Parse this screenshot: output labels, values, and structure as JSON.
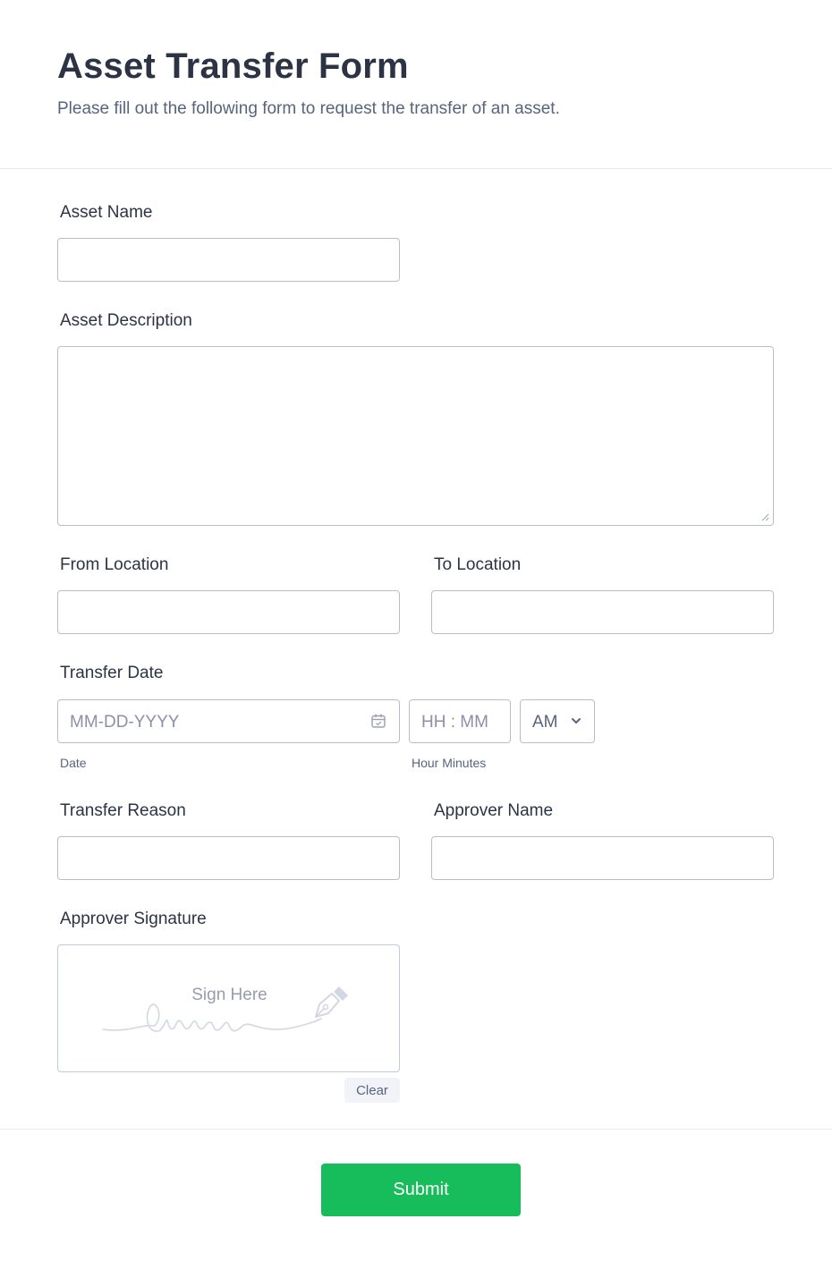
{
  "header": {
    "title": "Asset Transfer Form",
    "subtitle": "Please fill out the following form to request the transfer of an asset."
  },
  "fields": {
    "asset_name": {
      "label": "Asset Name",
      "value": ""
    },
    "asset_description": {
      "label": "Asset Description",
      "value": ""
    },
    "from_location": {
      "label": "From Location",
      "value": ""
    },
    "to_location": {
      "label": "To Location",
      "value": ""
    },
    "transfer_date": {
      "label": "Transfer Date",
      "date_placeholder": "MM-DD-YYYY",
      "date_sublabel": "Date",
      "time_placeholder": "HH : MM",
      "time_sublabel": "Hour Minutes",
      "ampm_selected": "AM"
    },
    "transfer_reason": {
      "label": "Transfer Reason",
      "value": ""
    },
    "approver_name": {
      "label": "Approver Name",
      "value": ""
    },
    "approver_signature": {
      "label": "Approver Signature",
      "placeholder": "Sign Here",
      "clear_label": "Clear"
    }
  },
  "submit_label": "Submit",
  "icons": {
    "date": "calendar-icon",
    "ampm": "chevron-down-icon",
    "signature": "pen-nib-icon"
  },
  "colors": {
    "submit": "#18bd5b",
    "text": "#2c3345",
    "muted": "#57647e",
    "border": "#b8bdc9"
  }
}
